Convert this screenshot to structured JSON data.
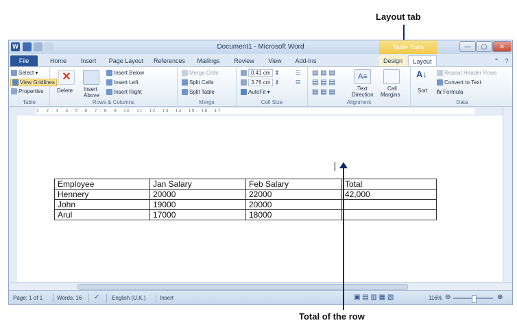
{
  "annotations": {
    "layout_tab": "Layout tab",
    "total_row": "Total of the row"
  },
  "window": {
    "title": "Document1 - Microsoft Word",
    "context_tab": "Table Tools"
  },
  "tabs": [
    "File",
    "Home",
    "Insert",
    "Page Layout",
    "References",
    "Mailings",
    "Review",
    "View",
    "Add-Ins",
    "Design",
    "Layout"
  ],
  "ribbon": {
    "table": {
      "label": "Table",
      "select": "Select",
      "view_gridlines": "View Gridlines",
      "properties": "Properties"
    },
    "rows_columns": {
      "label": "Rows & Columns",
      "delete": "Delete",
      "insert_above_1": "Insert",
      "insert_above_2": "Above",
      "insert_below": "Insert Below",
      "insert_left": "Insert Left",
      "insert_right": "Insert Right"
    },
    "merge": {
      "label": "Merge",
      "merge_cells": "Merge Cells",
      "split_cells": "Split Cells",
      "split_table": "Split Table"
    },
    "cell_size": {
      "label": "Cell Size",
      "height": "0.41 cm",
      "width": "3.76 cm",
      "autofit": "AutoFit"
    },
    "alignment": {
      "label": "Alignment",
      "text_direction_1": "Text",
      "text_direction_2": "Direction",
      "cell_margins_1": "Cell",
      "cell_margins_2": "Margins"
    },
    "data": {
      "label": "Data",
      "sort": "Sort",
      "repeat_header": "Repeat Header Rows",
      "convert": "Convert to Text",
      "formula": "Formula"
    }
  },
  "ruler_text": "1 · 2 · 3 · 4 · 5 · 6 · 7 · 8 · 9 · 10 · 11 · 12 · 13 · 14 · 15 · 16 · 17",
  "table": {
    "header": [
      "Employee",
      "Jan Salary",
      "Feb Salary",
      "Total"
    ],
    "rows": [
      [
        "Hennery",
        "20000",
        "22000",
        "42,000"
      ],
      [
        "John",
        "19000",
        "20000",
        ""
      ],
      [
        "Arul",
        "17000",
        "18000",
        ""
      ]
    ]
  },
  "status": {
    "page": "Page: 1 of 1",
    "words": "Words: 16",
    "language": "English (U.K.)",
    "mode": "Insert",
    "zoom": "116%"
  },
  "colors": {
    "accent": "#2a5699",
    "annotation_arrow": "#0b2a66"
  }
}
